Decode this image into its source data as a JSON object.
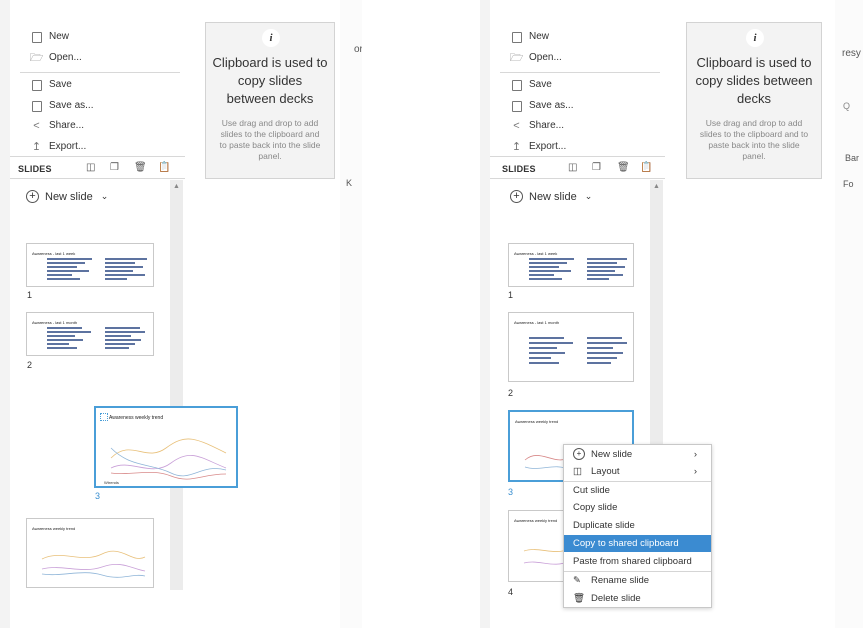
{
  "file_menu": {
    "new": "New",
    "open": "Open...",
    "save": "Save",
    "save_as": "Save as...",
    "share": "Share...",
    "export": "Export..."
  },
  "slides_panel": {
    "header": "SLIDES",
    "new_slide": "New slide"
  },
  "clipboard": {
    "heading": "Clipboard is used to copy slides between decks",
    "body": "Use drag and drop to add slides to the clipboard and to paste back into the slide panel."
  },
  "thumbnails": [
    {
      "number": "1",
      "title": "Awareness - last 1 week"
    },
    {
      "number": "2",
      "title": "Awareness - last 1 month"
    },
    {
      "number": "3",
      "title": "Awareness weekly trend"
    },
    {
      "number": "4",
      "title": "Awareness weekly trend"
    }
  ],
  "drag_preview": {
    "title": "Awareness weekly trend",
    "footer": "Wtrends"
  },
  "context_menu": {
    "new_slide": "New slide",
    "layout": "Layout",
    "cut_slide": "Cut slide",
    "copy_slide": "Copy slide",
    "duplicate_slide": "Duplicate slide",
    "copy_shared": "Copy to shared clipboard",
    "paste_shared": "Paste from shared clipboard",
    "rename_slide": "Rename slide",
    "delete_slide": "Delete slide"
  },
  "right_edge": {
    "partial_1": "resy",
    "partial_2": "Q",
    "partial_3": "Bar",
    "partial_4": "Fo"
  },
  "left_edge": {
    "partial_1": "or",
    "partial_2": "K"
  },
  "colors": {
    "accent": "#3b8bd1",
    "bar_dark": "#5d73a0",
    "panel_bg": "#f3f3f3"
  }
}
